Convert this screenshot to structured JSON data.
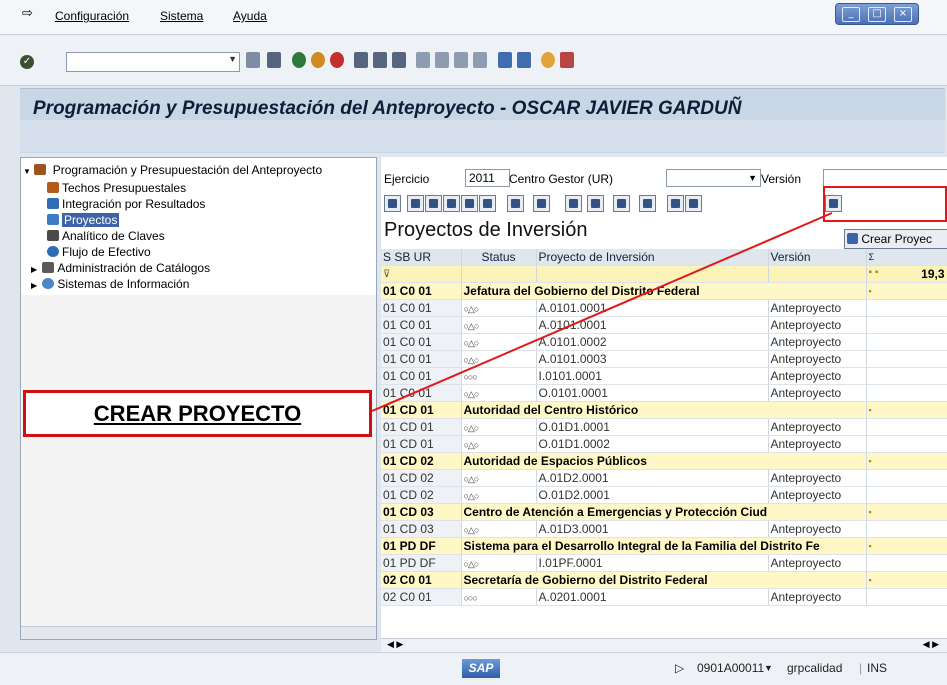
{
  "menu": {
    "items": [
      "Configuración",
      "Sistema",
      "Ayuda"
    ]
  },
  "title": "Programación y Presupuestación del Anteproyecto - OSCAR JAVIER GARDUÑ",
  "tree": {
    "root": "Programación y Presupuestación del Anteproyecto",
    "items": [
      {
        "label": "Techos Presupuestales",
        "color": "#b35a1f"
      },
      {
        "label": "Integración por Resultados",
        "color": "#2e6db5"
      },
      {
        "label": "Proyectos",
        "color": "#3e7bc7",
        "selected": true
      },
      {
        "label": "Analítico de Claves",
        "color": "#4a4a4a"
      },
      {
        "label": "Flujo de Efectivo",
        "color": "#2e6db5"
      }
    ],
    "folders": [
      "Administración de Catálogos",
      "Sistemas de Información"
    ]
  },
  "callout": "CREAR PROYECTO",
  "filters": {
    "ejercicio_label": "Ejercicio",
    "ejercicio": "2011",
    "centro_label": "Centro Gestor (UR)",
    "version_label": "Versión"
  },
  "crear_button": "Crear Proyec",
  "grid": {
    "title": "Proyectos de Inversión",
    "columns": [
      "S SB UR",
      "Status",
      "Proyecto de Inversión",
      "Versión",
      "Σ"
    ],
    "total_sum": "19,3",
    "rows": [
      {
        "type": "grp",
        "code": "01 C0 01",
        "desc": "Jefatura del Gobierno del Distrito Federal"
      },
      {
        "type": "it",
        "code": "01 C0 01",
        "status": "○△○",
        "proj": "A.0101.0001",
        "ver": "Anteproyecto"
      },
      {
        "type": "it",
        "code": "01 C0 01",
        "status": "○△○",
        "proj": "A.0101.0001",
        "ver": "Anteproyecto"
      },
      {
        "type": "it",
        "code": "01 C0 01",
        "status": "○△○",
        "proj": "A.0101.0002",
        "ver": "Anteproyecto"
      },
      {
        "type": "it",
        "code": "01 C0 01",
        "status": "○△○",
        "proj": "A.0101.0003",
        "ver": "Anteproyecto"
      },
      {
        "type": "it",
        "code": "01 C0 01",
        "status": "○○○",
        "proj": "I.0101.0001",
        "ver": "Anteproyecto"
      },
      {
        "type": "it",
        "code": "01 C0 01",
        "status": "○△○",
        "proj": "O.0101.0001",
        "ver": "Anteproyecto"
      },
      {
        "type": "grp",
        "code": "01 CD 01",
        "desc": "Autoridad del Centro Histórico"
      },
      {
        "type": "it",
        "code": "01 CD 01",
        "status": "○△○",
        "proj": "O.01D1.0001",
        "ver": "Anteproyecto"
      },
      {
        "type": "it",
        "code": "01 CD 01",
        "status": "○△○",
        "proj": "O.01D1.0002",
        "ver": "Anteproyecto"
      },
      {
        "type": "grp",
        "code": "01 CD 02",
        "desc": "Autoridad de Espacios Públicos"
      },
      {
        "type": "it",
        "code": "01 CD 02",
        "status": "○△○",
        "proj": "A.01D2.0001",
        "ver": "Anteproyecto"
      },
      {
        "type": "it",
        "code": "01 CD 02",
        "status": "○△○",
        "proj": "O.01D2.0001",
        "ver": "Anteproyecto"
      },
      {
        "type": "grp",
        "code": "01 CD 03",
        "desc": "Centro de Atención a Emergencias y Protección Ciud"
      },
      {
        "type": "it",
        "code": "01 CD 03",
        "status": "○△○",
        "proj": "A.01D3.0001",
        "ver": "Anteproyecto"
      },
      {
        "type": "grp",
        "code": "01 PD DF",
        "desc": "Sistema para el Desarrollo Integral de la Familia del Distrito Fe"
      },
      {
        "type": "it",
        "code": "01 PD DF",
        "status": "○△○",
        "proj": "I.01PF.0001",
        "ver": "Anteproyecto"
      },
      {
        "type": "grp",
        "code": "02 C0 01",
        "desc": "Secretaría de Gobierno del Distrito Federal"
      },
      {
        "type": "it",
        "code": "02 C0 01",
        "status": "○○○",
        "proj": "A.0201.0001",
        "ver": "Anteproyecto"
      }
    ]
  },
  "status": {
    "logo": "SAP",
    "session": "0901A00011",
    "client": "grpcalidad",
    "mode": "INS"
  }
}
